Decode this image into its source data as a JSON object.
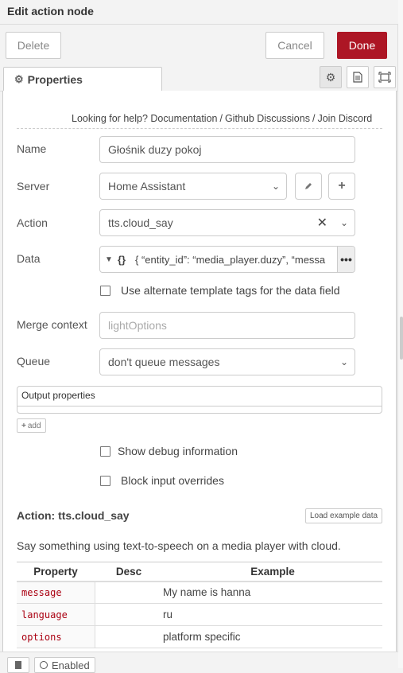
{
  "header": {
    "title": "Edit action node",
    "delete_label": "Delete",
    "cancel_label": "Cancel",
    "done_label": "Done"
  },
  "tabs": {
    "properties_label": "Properties",
    "icons": [
      "gear-icon",
      "description-icon",
      "appearance-icon"
    ]
  },
  "help": {
    "prefix": "Looking for help?",
    "links": [
      "Documentation",
      "Github Discussions",
      "Join Discord"
    ]
  },
  "form": {
    "name_label": "Name",
    "name_value": "Głośnik duzy pokoj",
    "server_label": "Server",
    "server_value": "Home Assistant",
    "action_label": "Action",
    "action_value": "tts.cloud_say",
    "data_label": "Data",
    "data_type": "{}",
    "data_value": "{ “entity_id”: “media_player.duzy”, “messa",
    "alt_template_label": "Use alternate template tags for the data field",
    "merge_label": "Merge context",
    "merge_placeholder": "lightOptions",
    "queue_label": "Queue",
    "queue_value": "don't queue messages",
    "output_properties_label": "Output properties",
    "add_label": "add",
    "debug_label": "Show debug information",
    "block_label": "Block input overrides"
  },
  "action_info": {
    "title": "Action: tts.cloud_say",
    "load_example_label": "Load example data",
    "description": "Say something using text-to-speech on a media player with cloud.",
    "columns": [
      "Property",
      "Desc",
      "Example"
    ],
    "rows": [
      {
        "property": "message",
        "desc": "",
        "example": "My name is hanna"
      },
      {
        "property": "language",
        "desc": "",
        "example": "ru"
      },
      {
        "property": "options",
        "desc": "",
        "example": "platform specific"
      }
    ]
  },
  "footer": {
    "enabled_label": "Enabled"
  },
  "colors": {
    "primary": "#ad1625",
    "property_name": "#aa1111"
  }
}
